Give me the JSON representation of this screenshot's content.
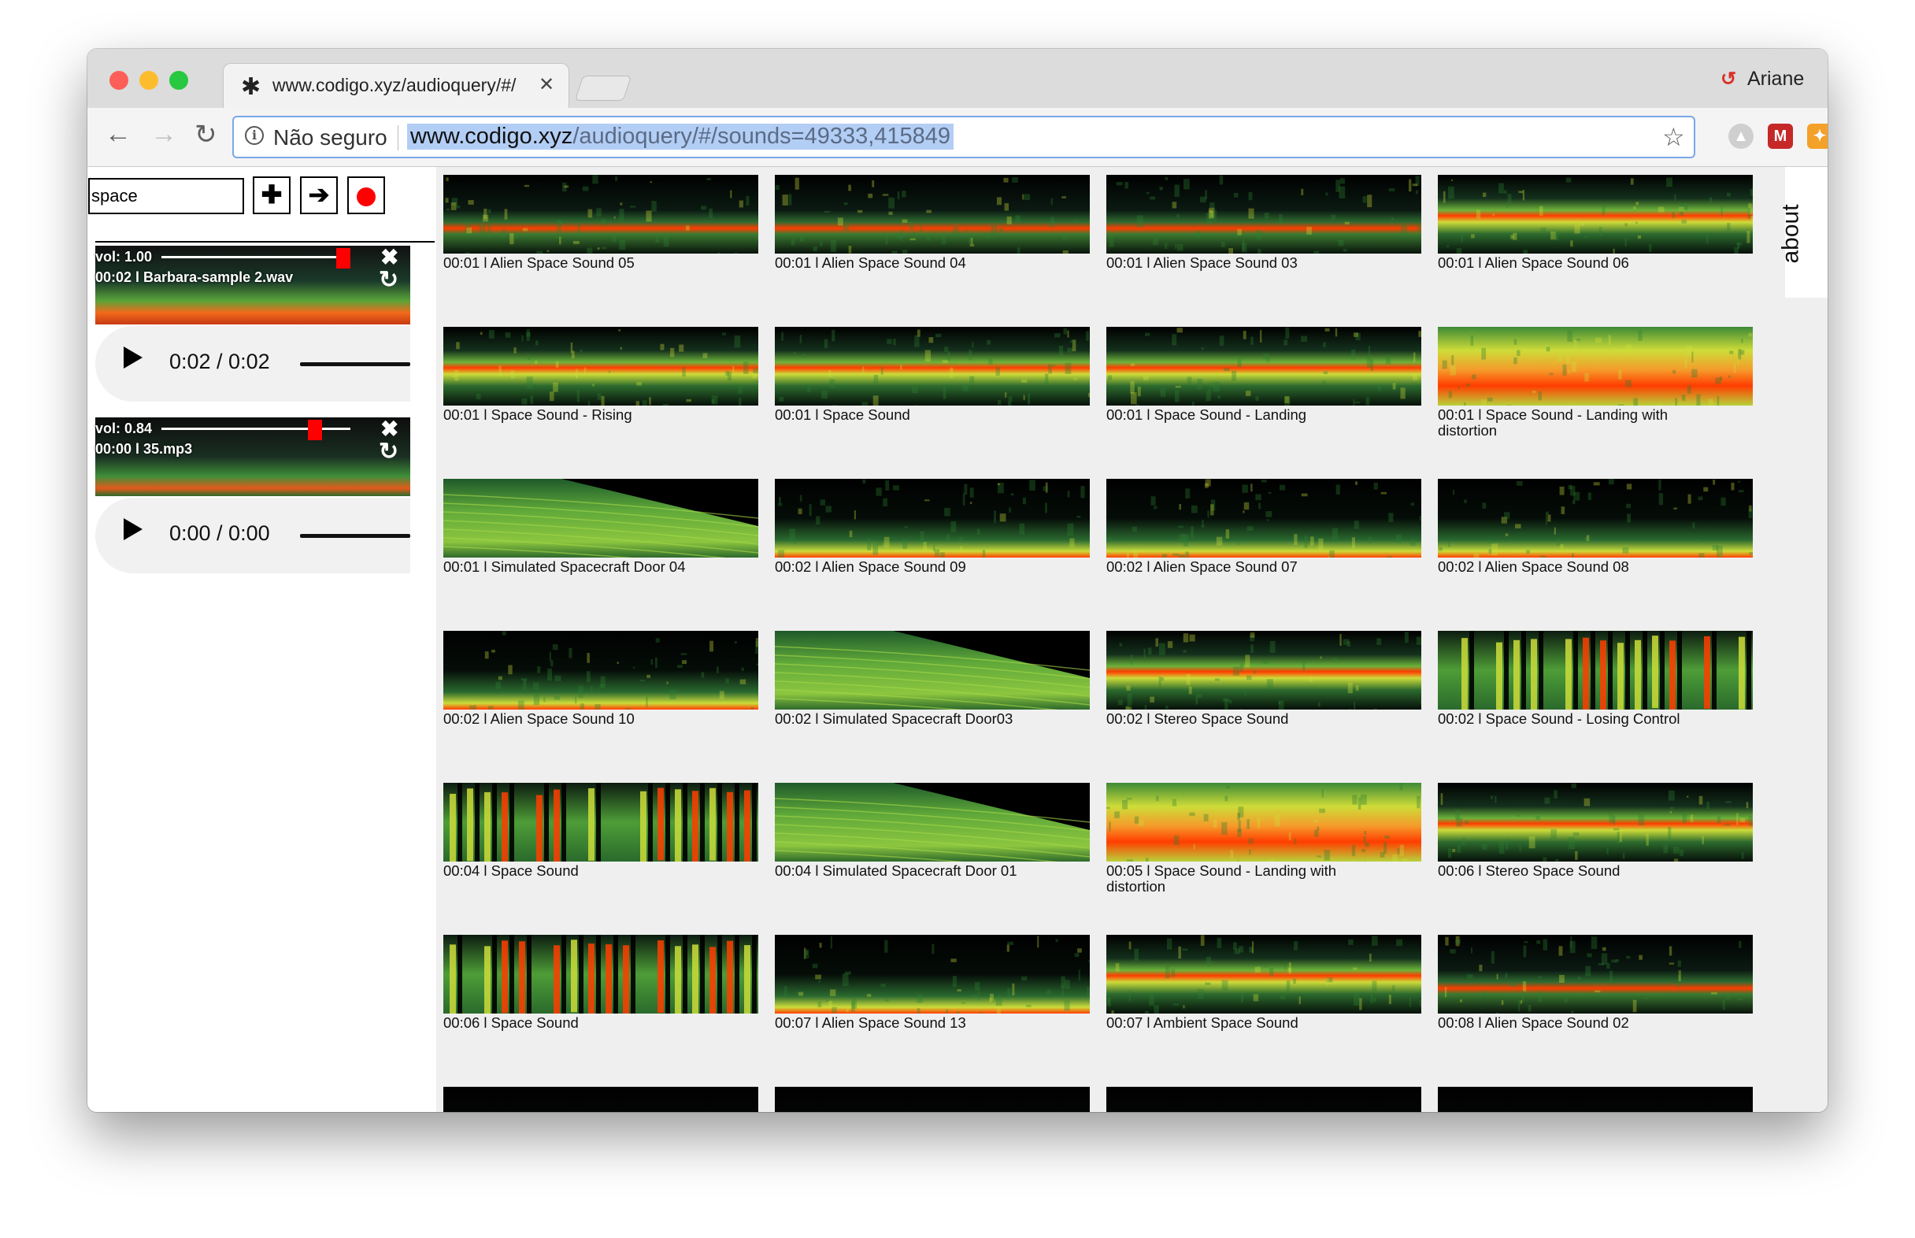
{
  "browser": {
    "tab_title": "www.codigo.xyz/audioquery/#/",
    "profile_name": "Ariane",
    "security_label": "Não seguro",
    "url_host": "www.codigo.xyz",
    "url_path": "/audioquery/#/sounds=49333,415849"
  },
  "sidebar": {
    "search_value": "space",
    "tracks": [
      {
        "volume": "vol: 1.00",
        "volume_level": 1.0,
        "name": "00:02 l Barbara-sample 2.wav",
        "time": "0:02 / 0:02"
      },
      {
        "volume": "vol: 0.84",
        "volume_level": 0.84,
        "name": "00:00 l 35.mp3",
        "time": "0:00 / 0:00"
      }
    ]
  },
  "about_label": "about",
  "sounds": [
    {
      "caption": "00:01 l Alien Space Sound 05",
      "style": "line"
    },
    {
      "caption": "00:01 l Alien Space Sound 04",
      "style": "line"
    },
    {
      "caption": "00:01 l Alien Space Sound 03",
      "style": "line"
    },
    {
      "caption": "00:01 l Alien Space Sound 06",
      "style": "band"
    },
    {
      "caption": "00:01 l Space Sound - Rising",
      "style": "band"
    },
    {
      "caption": "00:01 l Space Sound",
      "style": "band"
    },
    {
      "caption": "00:01 l Space Sound - Landing",
      "style": "band"
    },
    {
      "caption": "00:01 l Space Sound - Landing with distortion",
      "style": "full"
    },
    {
      "caption": "00:01 l Simulated Spacecraft Door 04",
      "style": "sweep"
    },
    {
      "caption": "00:02 l Alien Space Sound 09",
      "style": "low"
    },
    {
      "caption": "00:02 l Alien Space Sound 07",
      "style": "low"
    },
    {
      "caption": "00:02 l Alien Space Sound 08",
      "style": "low"
    },
    {
      "caption": "00:02 l Alien Space Sound 10",
      "style": "low"
    },
    {
      "caption": "00:02 l Simulated Spacecraft Door03",
      "style": "sweep"
    },
    {
      "caption": "00:02 l Stereo Space Sound",
      "style": "band"
    },
    {
      "caption": "00:02 l Space Sound - Losing Control",
      "style": "bars"
    },
    {
      "caption": "00:04 l Space Sound",
      "style": "bars"
    },
    {
      "caption": "00:04 l Simulated Spacecraft Door 01",
      "style": "sweep"
    },
    {
      "caption": "00:05 l Space Sound - Landing with distortion",
      "style": "full"
    },
    {
      "caption": "00:06 l Stereo Space Sound",
      "style": "band"
    },
    {
      "caption": "00:06 l Space Sound",
      "style": "bars"
    },
    {
      "caption": "00:07 l Alien Space Sound 13",
      "style": "low"
    },
    {
      "caption": "00:07 l Ambient Space Sound",
      "style": "band"
    },
    {
      "caption": "00:08 l Alien Space Sound 02",
      "style": "line"
    },
    {
      "caption": "",
      "style": "dark"
    },
    {
      "caption": "",
      "style": "dark"
    },
    {
      "caption": "",
      "style": "dark"
    },
    {
      "caption": "",
      "style": "dark"
    }
  ],
  "colors": {
    "record": "#ff0000",
    "selection": "#b3cef5",
    "spectrogram_bg": "#000000",
    "spectrogram_low": "#2e7d32",
    "spectrogram_mid": "#cddc39",
    "spectrogram_high": "#ff3d00"
  }
}
